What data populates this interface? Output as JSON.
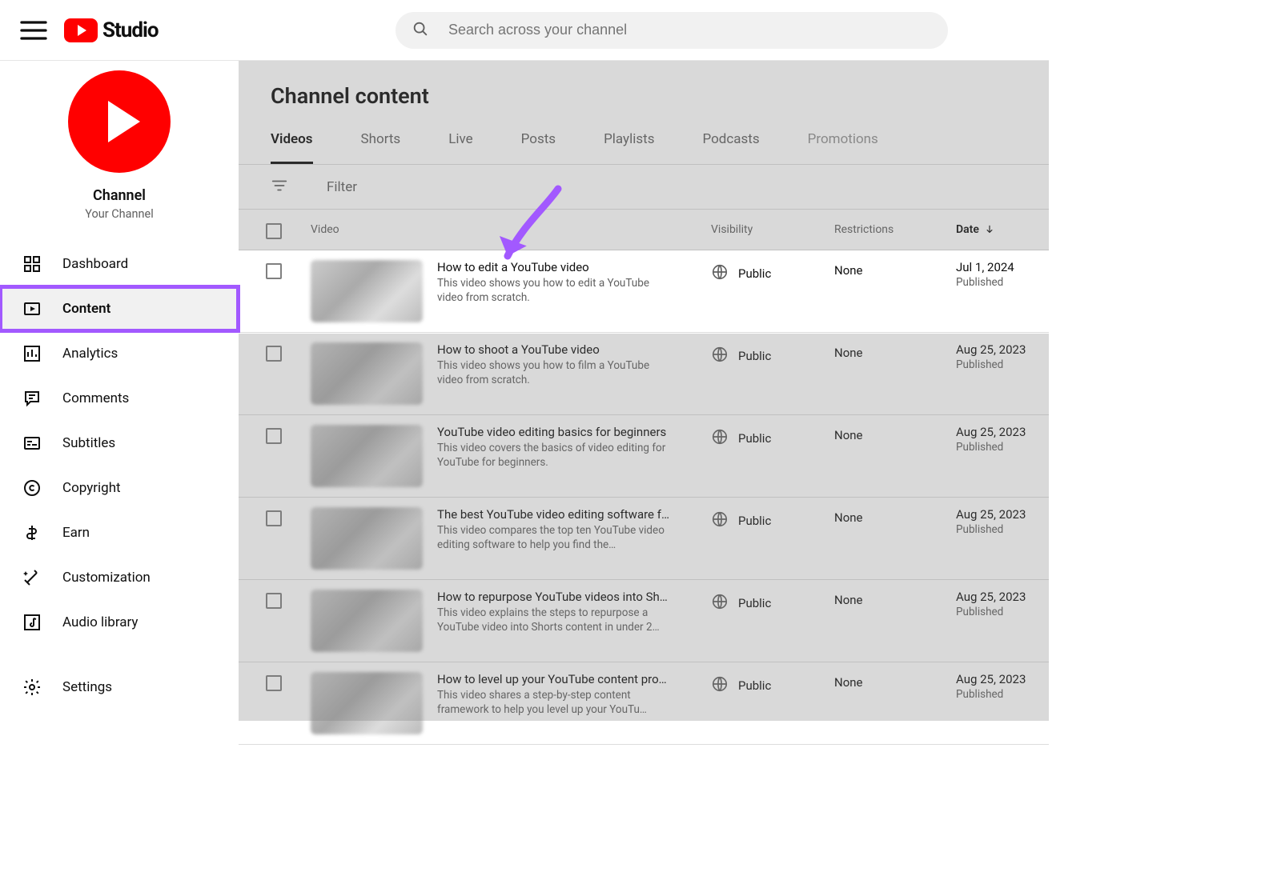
{
  "header": {
    "logo_text": "Studio",
    "search_placeholder": "Search across your channel"
  },
  "sidebar": {
    "channel_label": "Channel",
    "channel_sub": "Your Channel",
    "items": [
      {
        "label": "Dashboard"
      },
      {
        "label": "Content"
      },
      {
        "label": "Analytics"
      },
      {
        "label": "Comments"
      },
      {
        "label": "Subtitles"
      },
      {
        "label": "Copyright"
      },
      {
        "label": "Earn"
      },
      {
        "label": "Customization"
      },
      {
        "label": "Audio library"
      }
    ],
    "settings_label": "Settings"
  },
  "page": {
    "title": "Channel content",
    "tabs": [
      "Videos",
      "Shorts",
      "Live",
      "Posts",
      "Playlists",
      "Podcasts",
      "Promotions"
    ],
    "filter_placeholder": "Filter",
    "columns": {
      "video": "Video",
      "visibility": "Visibility",
      "restrictions": "Restrictions",
      "date": "Date"
    }
  },
  "rows": [
    {
      "title": "How to edit a YouTube video",
      "desc": "This video shows you how to edit a YouTube video from scratch.",
      "visibility": "Public",
      "restrictions": "None",
      "date": "Jul 1, 2024",
      "date_status": "Published"
    },
    {
      "title": "How to shoot a YouTube video",
      "desc": "This video shows you how to film a YouTube video from scratch.",
      "visibility": "Public",
      "restrictions": "None",
      "date": "Aug 25, 2023",
      "date_status": "Published"
    },
    {
      "title": "YouTube video editing basics for beginners",
      "desc": "This video covers the basics of video editing for YouTube for beginners.",
      "visibility": "Public",
      "restrictions": "None",
      "date": "Aug 25, 2023",
      "date_status": "Published"
    },
    {
      "title": "The best YouTube video editing software f…",
      "desc": "This video compares the top ten YouTube video editing software to help you find the…",
      "visibility": "Public",
      "restrictions": "None",
      "date": "Aug 25, 2023",
      "date_status": "Published"
    },
    {
      "title": "How to repurpose YouTube videos into Sh…",
      "desc": "This video explains the steps to repurpose a YouTube video into Shorts content in under 2…",
      "visibility": "Public",
      "restrictions": "None",
      "date": "Aug 25, 2023",
      "date_status": "Published"
    },
    {
      "title": "How to level up your YouTube content pro…",
      "desc": "This video shares a step-by-step content framework to help you level up your YouTu…",
      "visibility": "Public",
      "restrictions": "None",
      "date": "Aug 25, 2023",
      "date_status": "Published"
    }
  ]
}
